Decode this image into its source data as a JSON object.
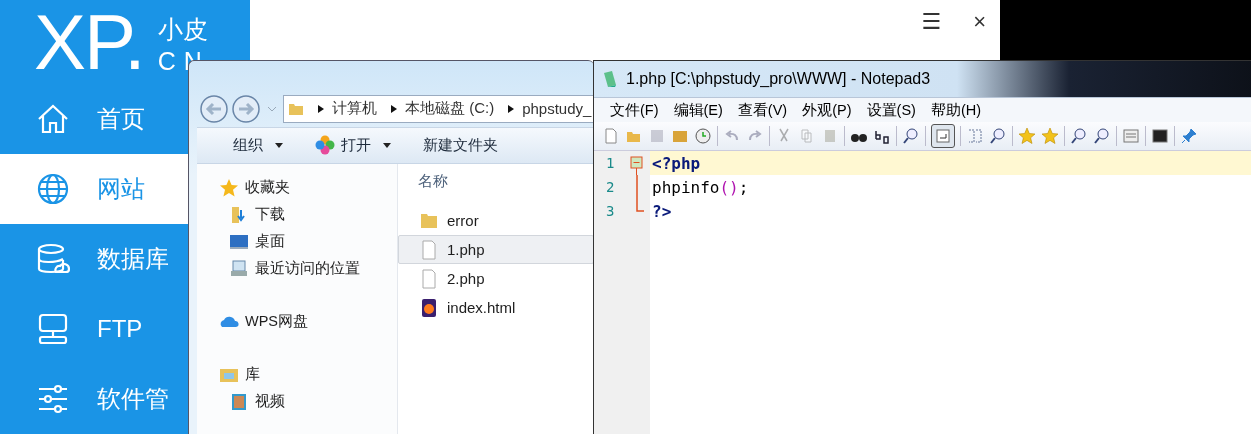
{
  "app": {
    "logo": {
      "mark": "XP.",
      "top": "小皮",
      "bottom": "CN"
    },
    "header_icons": [
      "☰",
      "×"
    ],
    "nav": [
      {
        "label": "首页",
        "selected": false
      },
      {
        "label": "网站",
        "selected": true
      },
      {
        "label": "数据库",
        "selected": false
      },
      {
        "label": "FTP",
        "selected": false
      },
      {
        "label": "软件管",
        "selected": false
      }
    ]
  },
  "explorer": {
    "breadcrumb": [
      "计算机",
      "本地磁盘 (C:)",
      "phpstudy_"
    ],
    "toolbar": [
      {
        "label": "组织",
        "kind": "menu"
      },
      {
        "label": "打开",
        "kind": "open"
      },
      {
        "label": "新建文件夹",
        "kind": "plain"
      }
    ],
    "tree": [
      {
        "label": "收藏夹",
        "children": [
          {
            "label": "下载"
          },
          {
            "label": "桌面"
          },
          {
            "label": "最近访问的位置"
          }
        ]
      },
      {
        "label": "WPS网盘"
      },
      {
        "label": "库",
        "children": [
          {
            "label": "视频"
          }
        ]
      }
    ],
    "column": "名称",
    "files": [
      {
        "name": "error",
        "kind": "folder",
        "selected": false
      },
      {
        "name": "1.php",
        "kind": "file",
        "selected": true
      },
      {
        "name": "2.php",
        "kind": "file",
        "selected": false
      },
      {
        "name": "index.html",
        "kind": "html",
        "selected": false
      }
    ]
  },
  "notepad": {
    "title": "1.php [C:\\phpstudy_pro\\WWW] - Notepad3",
    "menu": [
      "文件(F)",
      "编辑(E)",
      "查看(V)",
      "外观(P)",
      "设置(S)",
      "帮助(H)"
    ],
    "lines": [
      {
        "number": "1",
        "current": true,
        "tokens": [
          {
            "text": "<?php",
            "kind": "tag"
          }
        ]
      },
      {
        "number": "2",
        "current": false,
        "tokens": [
          {
            "text": "phpinfo",
            "kind": "plain"
          },
          {
            "text": "()",
            "kind": "paren"
          },
          {
            "text": ";",
            "kind": "plain"
          }
        ]
      },
      {
        "number": "3",
        "current": false,
        "tokens": [
          {
            "text": "?>",
            "kind": "tag"
          }
        ]
      }
    ]
  }
}
